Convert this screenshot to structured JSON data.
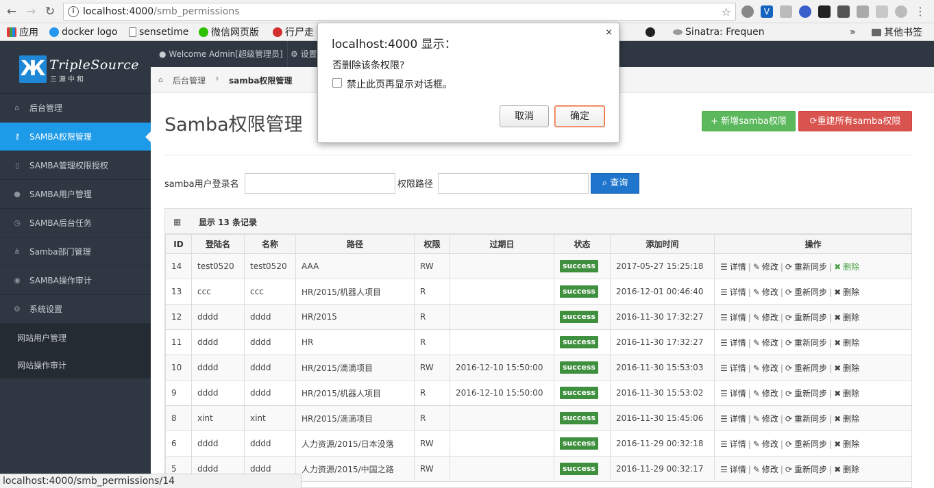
{
  "browser": {
    "url_host": "localhost:4000",
    "url_path": "/smb_permissions",
    "bookmarks": [
      {
        "label": "应用",
        "icon": "apps-icon"
      },
      {
        "label": "docker logo",
        "icon": "docker-icon"
      },
      {
        "label": "sensetime",
        "icon": "page-icon"
      },
      {
        "label": "微信网页版",
        "icon": "wechat-icon"
      },
      {
        "label": "行尸走",
        "icon": "flower-icon"
      },
      {
        "label": "Sinatra: Frequen",
        "icon": "sinatra-icon"
      }
    ],
    "bookmarks_more": "»",
    "other_bookmarks": "其他书签",
    "status_url": "localhost:4000/smb_permissions/14"
  },
  "sidebar": {
    "logo_text": "TripleSource",
    "logo_sub": "三源中和",
    "logo_mark": "Ж",
    "items": [
      {
        "label": "后台管理",
        "icon": "home-icon",
        "active": false
      },
      {
        "label": "SAMBA权限管理",
        "icon": "key-icon",
        "active": true
      },
      {
        "label": "SAMBA管理权限授权",
        "icon": "file-icon",
        "active": false
      },
      {
        "label": "SAMBA用户管理",
        "icon": "user-icon",
        "active": false
      },
      {
        "label": "SAMBA后台任务",
        "icon": "clock-icon",
        "active": false
      },
      {
        "label": "Samba部门管理",
        "icon": "sitemap-icon",
        "active": false
      },
      {
        "label": "SAMBA操作审计",
        "icon": "eye-icon",
        "active": false
      },
      {
        "label": "系统设置",
        "icon": "gears-icon",
        "active": false
      }
    ],
    "subitems": [
      "网站用户管理",
      "网站操作审计"
    ]
  },
  "topnav": {
    "welcome": "Welcome Admin[超级管理员]",
    "settings": "设置"
  },
  "breadcrumb": {
    "home": "后台管理",
    "separator": "›",
    "current": "samba权限管理"
  },
  "page": {
    "title": "Samba权限管理",
    "add_button": "+ 新增samba权限",
    "rebuild_button": "重建所有samba权限"
  },
  "search": {
    "login_label": "samba用户登录名",
    "login_value": "",
    "path_label": "权限路径",
    "path_value": "",
    "button": "查询"
  },
  "table": {
    "summary": "显示 13 条记录",
    "headers": [
      "ID",
      "登陆名",
      "名称",
      "路径",
      "权限",
      "过期日",
      "状态",
      "添加时间",
      "操作"
    ],
    "ops": {
      "detail": "详情",
      "edit": "修改",
      "resync": "重新同步",
      "delete": "删除"
    },
    "rows": [
      {
        "id": "14",
        "login": "test0520",
        "name": "test0520",
        "path": "AAA",
        "perm": "RW",
        "expire": "",
        "status": "success",
        "added": "2017-05-27 15:25:18",
        "delete_highlight": true
      },
      {
        "id": "13",
        "login": "ccc",
        "name": "ccc",
        "path": "HR/2015/机器人项目",
        "perm": "R",
        "expire": "",
        "status": "success",
        "added": "2016-12-01 00:46:40",
        "delete_highlight": false
      },
      {
        "id": "12",
        "login": "dddd",
        "name": "dddd",
        "path": "HR/2015",
        "perm": "R",
        "expire": "",
        "status": "success",
        "added": "2016-11-30 17:32:27",
        "delete_highlight": false
      },
      {
        "id": "11",
        "login": "dddd",
        "name": "dddd",
        "path": "HR",
        "perm": "R",
        "expire": "",
        "status": "success",
        "added": "2016-11-30 17:32:27",
        "delete_highlight": false
      },
      {
        "id": "10",
        "login": "dddd",
        "name": "dddd",
        "path": "HR/2015/滴滴项目",
        "perm": "RW",
        "expire": "2016-12-10 15:50:00",
        "status": "success",
        "added": "2016-11-30 15:53:03",
        "delete_highlight": false
      },
      {
        "id": "9",
        "login": "dddd",
        "name": "dddd",
        "path": "HR/2015/机器人项目",
        "perm": "R",
        "expire": "2016-12-10 15:50:00",
        "status": "success",
        "added": "2016-11-30 15:53:02",
        "delete_highlight": false
      },
      {
        "id": "8",
        "login": "xint",
        "name": "xint",
        "path": "HR/2015/滴滴项目",
        "perm": "R",
        "expire": "",
        "status": "success",
        "added": "2016-11-30 15:45:06",
        "delete_highlight": false
      },
      {
        "id": "6",
        "login": "dddd",
        "name": "dddd",
        "path": "人力资源/2015/日本没落",
        "perm": "RW",
        "expire": "",
        "status": "success",
        "added": "2016-11-29 00:32:18",
        "delete_highlight": false
      },
      {
        "id": "5",
        "login": "dddd",
        "name": "dddd",
        "path": "人力资源/2015/中国之路",
        "perm": "RW",
        "expire": "",
        "status": "success",
        "added": "2016-11-29 00:32:17",
        "delete_highlight": false
      }
    ]
  },
  "dialog": {
    "title": "localhost:4000 显示：",
    "message": "否删除该条权限?",
    "checkbox_label": "禁止此页再显示对话框。",
    "cancel": "取消",
    "ok": "确定",
    "close": "×"
  }
}
